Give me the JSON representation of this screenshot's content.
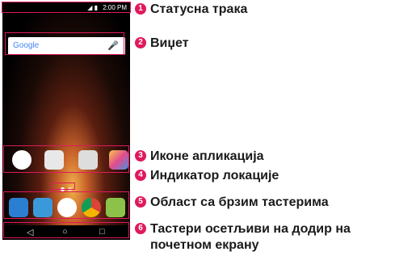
{
  "status_bar": {
    "time": "2:00 PM"
  },
  "widget": {
    "brand": "Google"
  },
  "callouts": [
    {
      "number": "1",
      "label": "Статусна трака"
    },
    {
      "number": "2",
      "label": "Виџет"
    },
    {
      "number": "3",
      "label": "Иконе апликација"
    },
    {
      "number": "4",
      "label": "Индикатор локације"
    },
    {
      "number": "5",
      "label": "Област са брзим тастерима"
    },
    {
      "number": "6",
      "label": "Тастери осетљиви на додир на",
      "label_line2": "почетном екрану"
    }
  ],
  "colors": {
    "accent": "#e0195c"
  }
}
